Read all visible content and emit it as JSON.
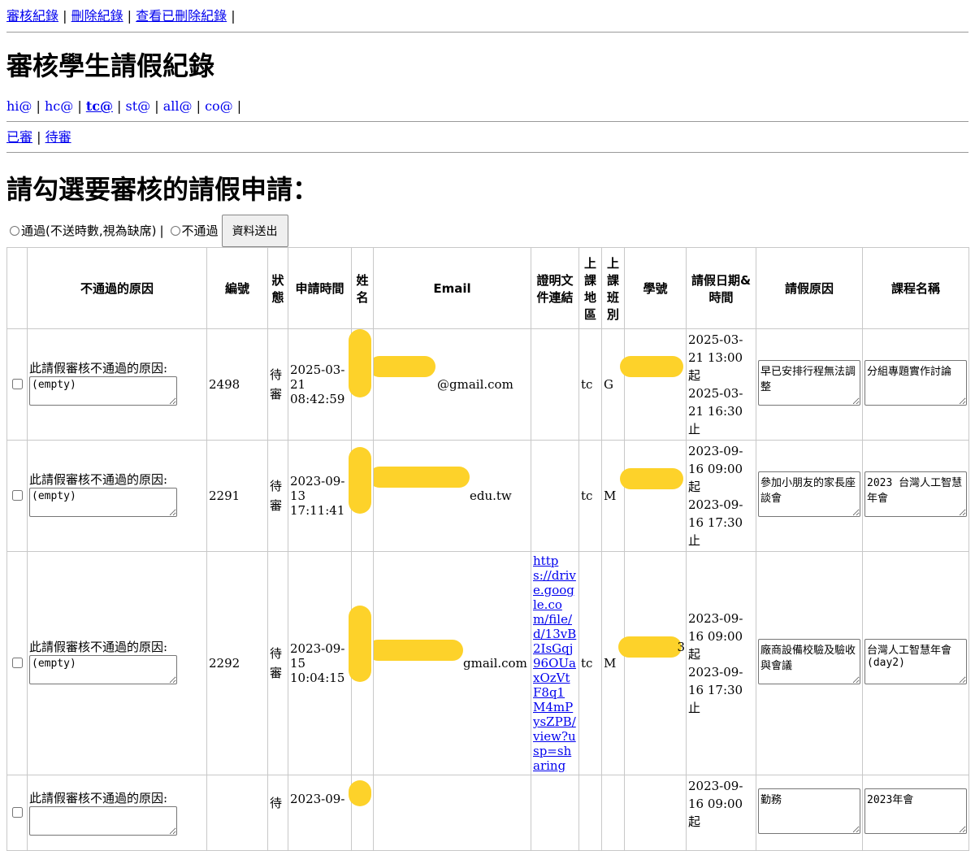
{
  "topnav": {
    "links": [
      "審核紀錄",
      "刪除紀錄",
      "查看已刪除紀錄"
    ]
  },
  "title": "審核學生請假紀錄",
  "tabs": [
    "hi@",
    "hc@",
    "tc@",
    "st@",
    "all@",
    "co@"
  ],
  "active_tab": "tc@",
  "filter_links": [
    "已審",
    "待審"
  ],
  "subtitle": "請勾選要審核的請假申請：",
  "form": {
    "approve_label": "通過(不送時數,視為缺席)",
    "reject_label": "不通過",
    "submit_label": "資料送出"
  },
  "table": {
    "headers": [
      "不通過的原因",
      "編號",
      "狀態",
      "申請時間",
      "姓名",
      "Email",
      "證明文件連結",
      "上課地區",
      "上課班別",
      "學號",
      "請假日期&時間",
      "請假原因",
      "課程名稱"
    ],
    "reason_prompt": "此請假審核不通過的原因:",
    "rows": [
      {
        "reason": "(empty)",
        "id": "2498",
        "status": "待審",
        "applied": "2025-03-21 08:42:59",
        "email_visible": "@gmail.com",
        "proof": "",
        "region": "tc",
        "class": "G",
        "leave_start": "2025-03-21 13:00起",
        "leave_end": "2025-03-21 16:30止",
        "leave_reason": "早已安排行程無法調整",
        "course": "分組專題實作討論"
      },
      {
        "reason": "(empty)",
        "id": "2291",
        "status": "待審",
        "applied": "2023-09-13 17:11:41",
        "email_visible": "edu.tw",
        "proof": "",
        "region": "tc",
        "class": "M",
        "leave_start": "2023-09-16 09:00起",
        "leave_end": "2023-09-16 17:30止",
        "leave_reason": "參加小朋友的家長座談會",
        "course": "2023 台灣人工智慧年會"
      },
      {
        "reason": "(empty)",
        "id": "2292",
        "status": "待審",
        "applied": "2023-09-15 10:04:15",
        "email_visible": "gmail.com",
        "proof": "https://drive.google.com/file/d/13vB2IsGqj96OUaxOzVtF8q1M4mPysZPB/view?usp=sharing",
        "region": "tc",
        "class": "M",
        "student_id_suffix": "3",
        "leave_start": "2023-09-16 09:00起",
        "leave_end": "2023-09-16 17:30止",
        "leave_reason": "廠商設備校驗及驗收與會議",
        "course": "台灣人工智慧年會(day2)"
      },
      {
        "reason": "",
        "id": "",
        "status": "待",
        "applied": "2023-09-",
        "email_visible": "",
        "proof": "",
        "region": "",
        "class": "",
        "leave_start": "2023-09-16 09:00起",
        "leave_end": "",
        "leave_reason": "勤務",
        "course": "2023年會"
      }
    ]
  },
  "colors": {
    "link": "#0000ee",
    "redaction": "#fdd22a",
    "border": "#c8c8c8"
  }
}
